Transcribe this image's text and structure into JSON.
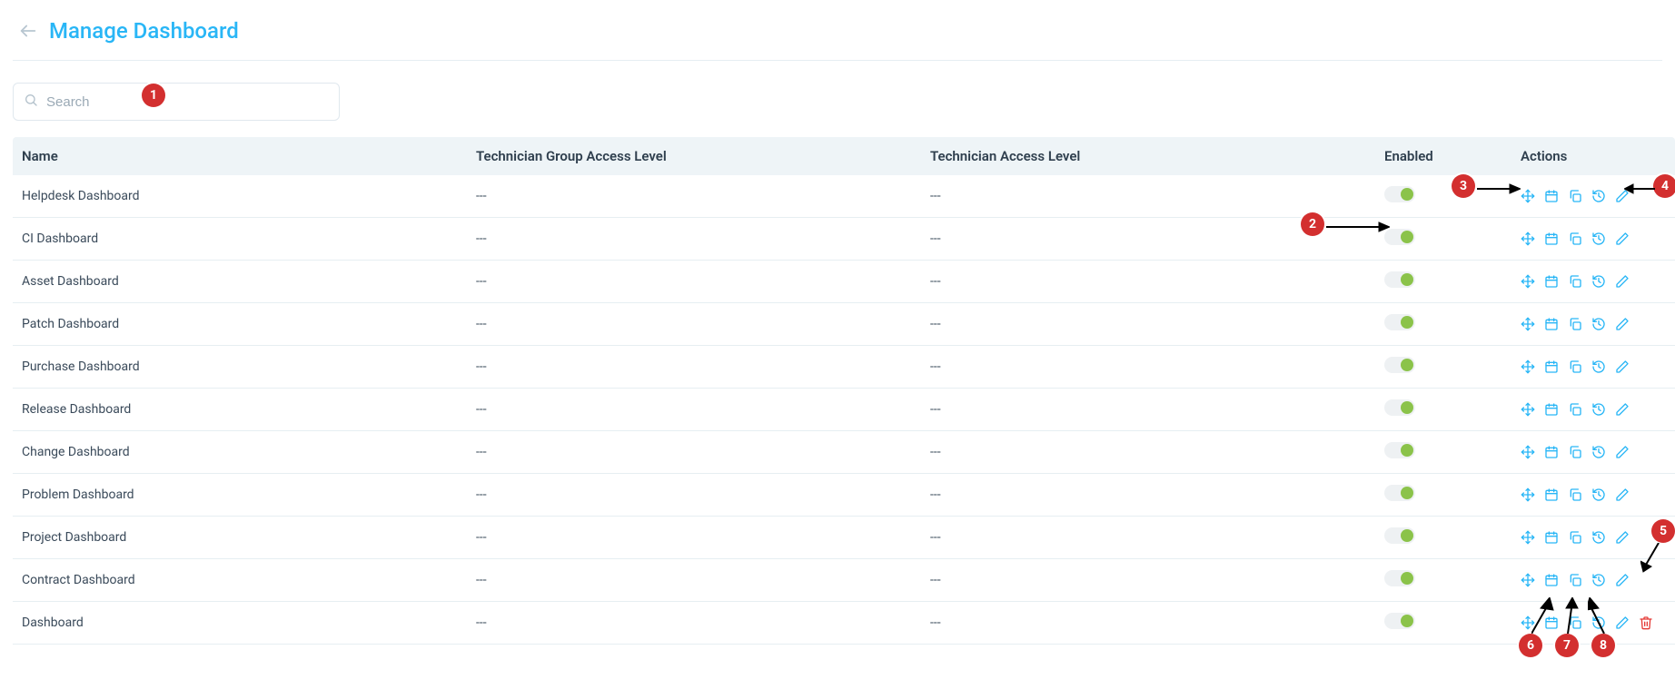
{
  "header": {
    "title": "Manage Dashboard"
  },
  "search": {
    "placeholder": "Search",
    "value": ""
  },
  "columns": {
    "name": "Name",
    "group": "Technician Group Access Level",
    "tech": "Technician Access Level",
    "enabled": "Enabled",
    "actions": "Actions"
  },
  "empty_cell": "---",
  "rows": [
    {
      "name": "Helpdesk Dashboard",
      "group": "---",
      "tech": "---",
      "enabled": true,
      "deletable": false
    },
    {
      "name": "CI Dashboard",
      "group": "---",
      "tech": "---",
      "enabled": true,
      "deletable": false
    },
    {
      "name": "Asset Dashboard",
      "group": "---",
      "tech": "---",
      "enabled": true,
      "deletable": false
    },
    {
      "name": "Patch Dashboard",
      "group": "---",
      "tech": "---",
      "enabled": true,
      "deletable": false
    },
    {
      "name": "Purchase Dashboard",
      "group": "---",
      "tech": "---",
      "enabled": true,
      "deletable": false
    },
    {
      "name": "Release Dashboard",
      "group": "---",
      "tech": "---",
      "enabled": true,
      "deletable": false
    },
    {
      "name": "Change Dashboard",
      "group": "---",
      "tech": "---",
      "enabled": true,
      "deletable": false
    },
    {
      "name": "Problem Dashboard",
      "group": "---",
      "tech": "---",
      "enabled": true,
      "deletable": false
    },
    {
      "name": "Project Dashboard",
      "group": "---",
      "tech": "---",
      "enabled": true,
      "deletable": false
    },
    {
      "name": "Contract Dashboard",
      "group": "---",
      "tech": "---",
      "enabled": true,
      "deletable": false
    },
    {
      "name": "Dashboard",
      "group": "---",
      "tech": "---",
      "enabled": true,
      "deletable": true
    }
  ],
  "icons": {
    "move": "move-icon",
    "calendar": "calendar-icon",
    "copy": "copy-icon",
    "history": "history-icon",
    "edit": "edit-icon",
    "delete": "delete-icon"
  },
  "callouts": [
    "1",
    "2",
    "3",
    "4",
    "5",
    "6",
    "7",
    "8"
  ]
}
